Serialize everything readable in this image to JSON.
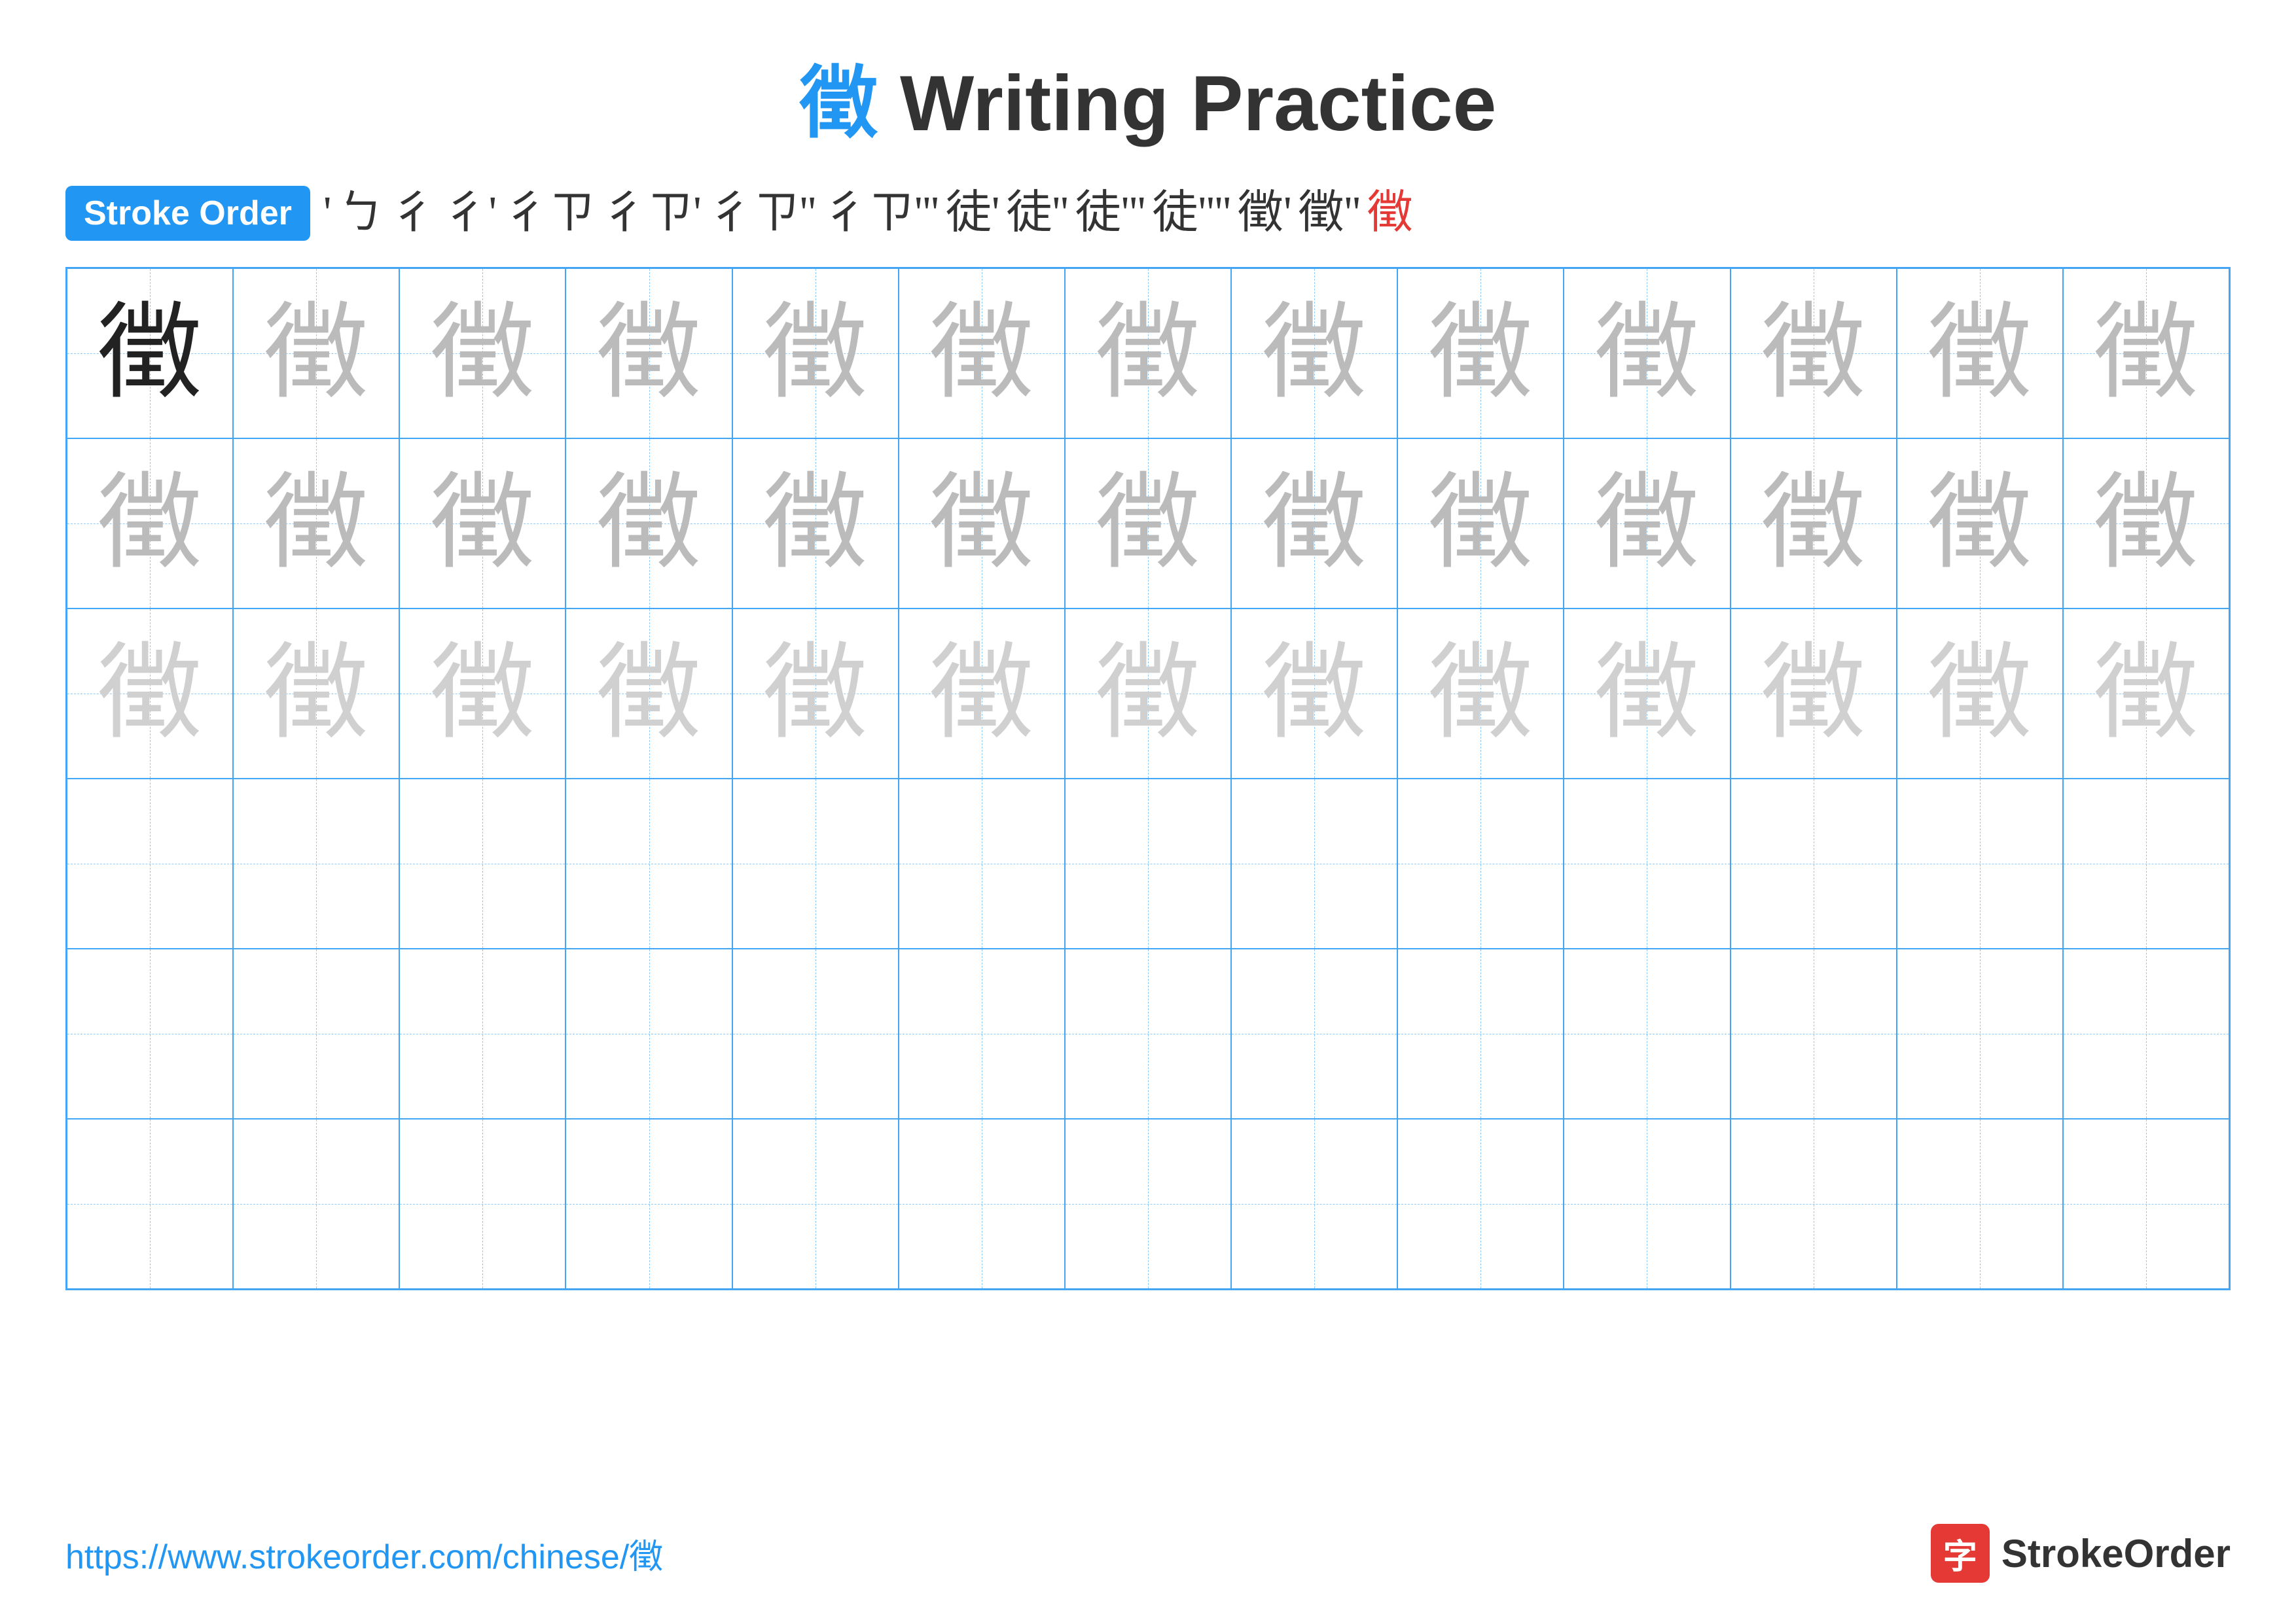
{
  "title": {
    "char": "徵",
    "text": " Writing Practice"
  },
  "stroke_order": {
    "badge_label": "Stroke Order",
    "steps": [
      "'",
      "ㄅ",
      "彳",
      "彳'",
      "彳ㄗ",
      "彳ㄗ'",
      "彳ㄗ''",
      "彳ㄗ'''",
      "徒'",
      "徒''",
      "徒'''",
      "徒''''",
      "徵'",
      "徵''",
      "徵"
    ]
  },
  "grid": {
    "rows": 6,
    "cols": 13,
    "char": "徵",
    "row_types": [
      "dark_then_medium",
      "medium",
      "light",
      "empty",
      "empty",
      "empty"
    ]
  },
  "footer": {
    "url": "https://www.strokeorder.com/chinese/徵",
    "logo_char": "字",
    "logo_text": "StrokeOrder"
  }
}
